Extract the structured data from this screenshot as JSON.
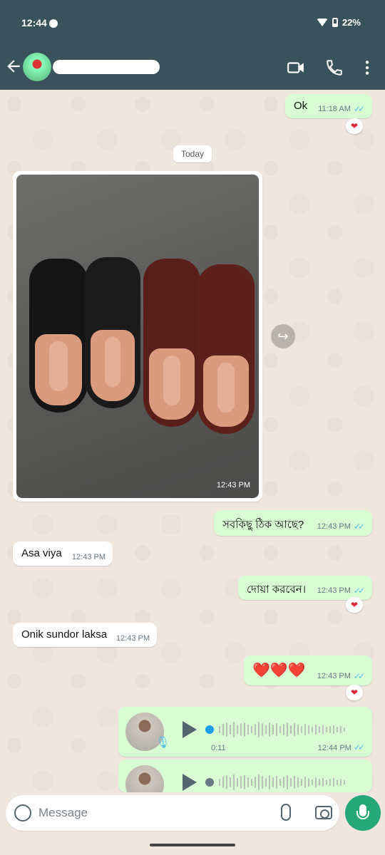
{
  "status_bar": {
    "time": "12:44",
    "battery": "22%"
  },
  "header": {
    "contact_name": "",
    "icons": [
      "back-arrow-icon",
      "video-call-icon",
      "voice-call-icon",
      "more-options-icon"
    ]
  },
  "colors": {
    "header_bg": "#3a525c",
    "outgoing_bubble": "#d9fdd3",
    "incoming_bubble": "#ffffff",
    "read_ticks": "#53bdeb",
    "mic_button": "#25a777"
  },
  "chat": {
    "msg_ok": {
      "text": "Ok",
      "time": "11:18 AM",
      "reaction": "❤"
    },
    "date_divider": "Today",
    "photo": {
      "time": "12:43 PM"
    },
    "msg_bangla_1": {
      "text": "সবকিছু ঠিক আছে?",
      "time": "12:43 PM"
    },
    "msg_asa": {
      "text": "Asa viya",
      "time": "12:43 PM"
    },
    "msg_bangla_2": {
      "text": "দোয়া করবেন।",
      "time": "12:43 PM",
      "reaction": "❤"
    },
    "msg_onik": {
      "text": "Onik sundor laksa",
      "time": "12:43 PM"
    },
    "msg_hearts": {
      "text": "❤️❤️❤️",
      "time": "12:43 PM",
      "reaction": "❤"
    },
    "voice_1": {
      "duration": "0:11",
      "time": "12:44 PM"
    }
  },
  "composer": {
    "placeholder": "Message"
  }
}
